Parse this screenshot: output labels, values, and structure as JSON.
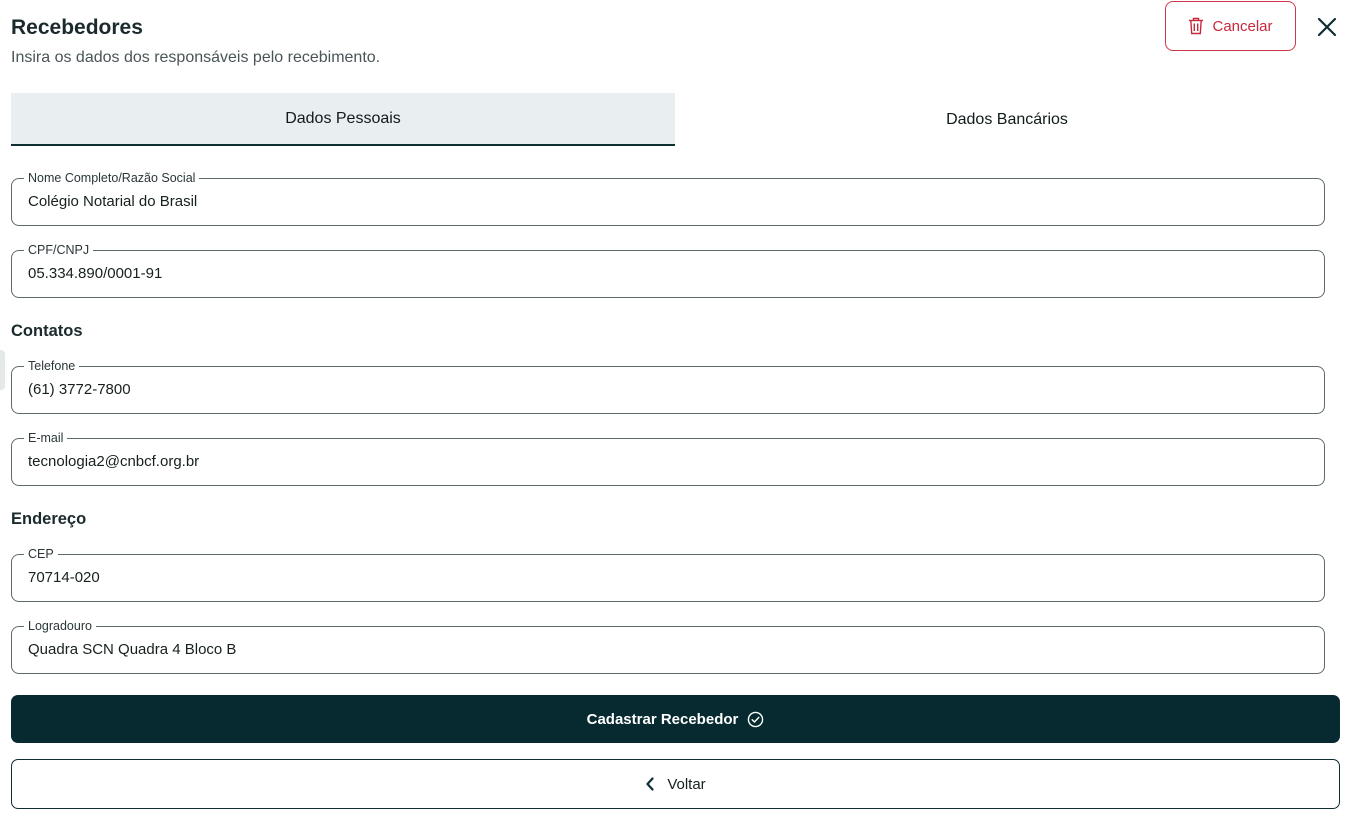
{
  "header": {
    "title": "Recebedores",
    "subtitle": "Insira os dados dos responsáveis pelo recebimento.",
    "cancel_label": "Cancelar"
  },
  "tabs": [
    {
      "label": "Dados Pessoais",
      "active": true
    },
    {
      "label": "Dados Bancários",
      "active": false
    }
  ],
  "fields": {
    "nome": {
      "label": "Nome Completo/Razão Social",
      "value": "Colégio Notarial do Brasil"
    },
    "cpf": {
      "label": "CPF/CNPJ",
      "value": "05.334.890/0001-91"
    },
    "telefone": {
      "label": "Telefone",
      "value": "(61) 3772-7800"
    },
    "email": {
      "label": "E-mail",
      "value": "tecnologia2@cnbcf.org.br"
    },
    "cep": {
      "label": "CEP",
      "value": "70714-020"
    },
    "logradouro": {
      "label": "Logradouro",
      "value": "Quadra SCN Quadra 4 Bloco B"
    }
  },
  "sections": {
    "contatos": "Contatos",
    "endereco": "Endereço"
  },
  "actions": {
    "submit_label": "Cadastrar Recebedor",
    "back_label": "Voltar"
  },
  "icons": {
    "cancel": "trash-icon",
    "close": "close-icon",
    "submit": "check-circle-icon",
    "back": "chevron-left-icon"
  },
  "colors": {
    "primary": "#062a30",
    "danger": "#c8283c",
    "tab_active_bg": "#e9eef0"
  }
}
